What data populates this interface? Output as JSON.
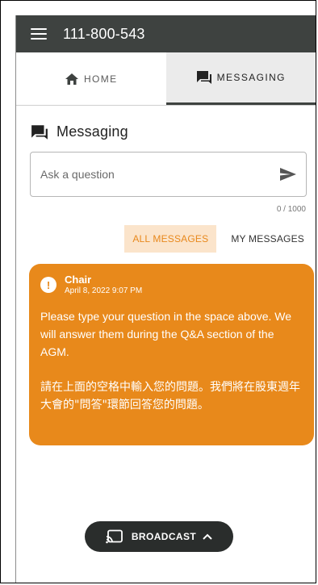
{
  "header": {
    "title": "111-800-543"
  },
  "tabs": [
    {
      "label": "HOME",
      "icon": "home-icon",
      "active": false
    },
    {
      "label": "MESSAGING",
      "icon": "messaging-icon",
      "active": true
    }
  ],
  "messaging": {
    "title": "Messaging",
    "input_placeholder": "Ask a question",
    "counter": "0 / 1000",
    "filters": [
      {
        "label": "ALL MESSAGES",
        "active": true
      },
      {
        "label": "MY MESSAGES",
        "active": false
      }
    ],
    "messages": [
      {
        "sender": "Chair",
        "timestamp": "April 8, 2022 9:07 PM",
        "text_en": "Please type your question in the space above. We will answer them during the Q&A section of the AGM.",
        "text_zh": "請在上面的空格中輸入您的問題。我們將在股東週年大會的\"問答\"環節回答您的問題。"
      }
    ]
  },
  "broadcast": {
    "label": "BROADCAST"
  },
  "colors": {
    "topbar": "#3e4240",
    "accent": "#e8891b",
    "filter_active_bg": "#fbe4cb"
  }
}
